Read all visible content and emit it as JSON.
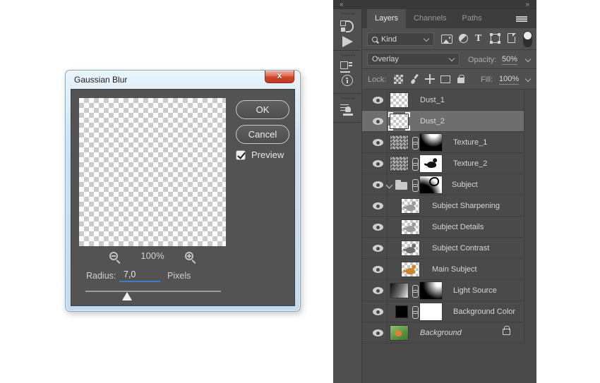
{
  "colors": {
    "accent_blue": "#3f7cc4",
    "selected_row": "#6e6e6e",
    "panel_bg": "#4a4a4a",
    "dialog_content_bg": "#535353",
    "close_red": "#cf4830"
  },
  "dialog": {
    "title": "Gaussian Blur",
    "close_glyph": "x",
    "ok_label": "OK",
    "cancel_label": "Cancel",
    "preview_label": "Preview",
    "preview_checked": true,
    "zoom_value": "100%",
    "radius_label": "Radius:",
    "radius_value": "7,0",
    "radius_unit": "Pixels"
  },
  "panel": {
    "collapse_left": "«",
    "collapse_right": "»",
    "tabs": [
      {
        "label": "Layers",
        "active": true
      },
      {
        "label": "Channels",
        "active": false
      },
      {
        "label": "Paths",
        "active": false
      }
    ],
    "filter": {
      "kind_label": "Kind",
      "type_icon_glyph": "T"
    },
    "blend": {
      "mode": "Overlay",
      "opacity_label": "Opacity:",
      "opacity_value": "50%"
    },
    "lock": {
      "label": "Lock:",
      "fill_label": "Fill:",
      "fill_value": "100%"
    },
    "layers": [
      {
        "name": "Dust_1"
      },
      {
        "name": "Dust_2",
        "selected": true
      },
      {
        "name": "Texture_1"
      },
      {
        "name": "Texture_2"
      },
      {
        "name": "Subject",
        "group": true,
        "expanded": true
      },
      {
        "name": "Subject Sharpening",
        "child": true
      },
      {
        "name": "Subject Details",
        "child": true
      },
      {
        "name": "Subject Contrast",
        "child": true
      },
      {
        "name": "Main Subject",
        "child": true
      },
      {
        "name": "Light Source"
      },
      {
        "name": "Background Color"
      },
      {
        "name": "Background",
        "italic": true,
        "locked": true
      }
    ]
  }
}
